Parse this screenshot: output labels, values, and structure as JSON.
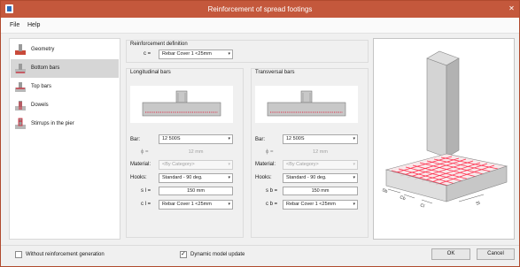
{
  "window": {
    "title": "Reinforcement of spread footings",
    "close_glyph": "✕"
  },
  "menu": {
    "file": "File",
    "help": "Help"
  },
  "nav": {
    "items": [
      {
        "label": "Geometry",
        "icon": "footing-geometry-icon"
      },
      {
        "label": "Bottom bars",
        "icon": "bottom-bars-icon",
        "selected": true
      },
      {
        "label": "Top bars",
        "icon": "top-bars-icon"
      },
      {
        "label": "Dowels",
        "icon": "dowels-icon"
      },
      {
        "label": "Stirrups in the pier",
        "icon": "pier-stirrups-icon"
      }
    ]
  },
  "reinforcement_definition": {
    "heading": "Reinforcement definition",
    "c_label": "c =",
    "c_value": "Rebar Cover 1 <25mm"
  },
  "longitudinal": {
    "heading": "Longitudinal bars",
    "bar_label": "Bar:",
    "bar_value": "12 500S",
    "phi_label": "ϕ =",
    "phi_value": "12 mm",
    "material_label": "Material:",
    "material_value": "<By Category>",
    "hooks_label": "Hooks:",
    "hooks_value": "Standard - 90 deg.",
    "s_label": "s l =",
    "s_value": "150 mm",
    "c_label": "c l =",
    "c_value": "Rebar Cover 1 <25mm"
  },
  "transversal": {
    "heading": "Transversal bars",
    "bar_label": "Bar:",
    "bar_value": "12 500S",
    "phi_label": "ϕ =",
    "phi_value": "12 mm",
    "material_label": "Material:",
    "material_value": "<By Category>",
    "hooks_label": "Hooks:",
    "hooks_value": "Standard - 90 deg.",
    "s_label": "s b =",
    "s_value": "150 mm",
    "c_label": "c b =",
    "c_value": "Rebar Cover 1 <25mm"
  },
  "preview": {
    "dim_labels": [
      "Sb",
      "Cb",
      "Cl",
      "Sl"
    ]
  },
  "footer": {
    "without_generation": "Without reinforcement generation",
    "without_generation_checked": false,
    "dynamic_update": "Dynamic model update",
    "dynamic_update_checked": true,
    "ok": "OK",
    "cancel": "Cancel"
  },
  "colors": {
    "titlebar": "#c4583c",
    "rebar": "#e0304a",
    "selection": "#d6d6d6"
  }
}
